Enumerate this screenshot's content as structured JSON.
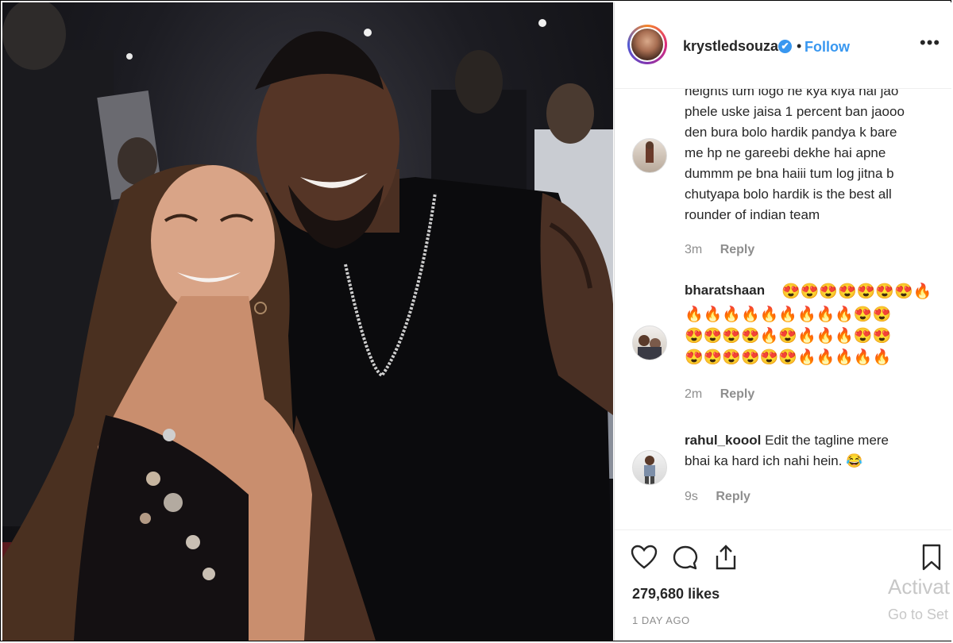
{
  "header": {
    "username": "krystledsouza",
    "verified_mark": "✔",
    "separator": "•",
    "follow_label": "Follow",
    "more_label": "•••"
  },
  "comments": [
    {
      "text_lines": [
        "heights tum logo ne kya kiya hai jao",
        "phele uske jaisa 1 percent ban jaooo",
        "den bura bolo hardik pandya k bare",
        "me hp ne gareebi dekhe hai apne",
        "dummm pe bna haiii tum log jitna b",
        "chutyapa bolo hardik is the best all",
        "rounder of indian team"
      ],
      "time": "3m",
      "reply_label": "Reply"
    },
    {
      "username": "bharatshaan",
      "emoji_lines": [
        "😍😍😍😍😍😍😍🔥",
        "🔥🔥🔥🔥🔥🔥🔥🔥🔥😍😍",
        "😍😍😍😍🔥😍🔥🔥🔥😍😍",
        "😍😍😍😍😍😍🔥🔥🔥🔥🔥"
      ],
      "time": "2m",
      "reply_label": "Reply"
    },
    {
      "username": "rahul_koool",
      "text_line1": "Edit the tagline mere",
      "text_line2": "bhai ka hard ich nahi hein. 😂",
      "time": "9s",
      "reply_label": "Reply"
    }
  ],
  "actions": {
    "icons": [
      "heart-icon",
      "comment-icon",
      "share-icon",
      "bookmark-icon"
    ],
    "likes": "279,680 likes",
    "date": "1 DAY AGO"
  },
  "watermark": {
    "line1": "Activat",
    "line2": "Go to Set"
  },
  "colors": {
    "link_blue": "#3897f0",
    "text": "#262626",
    "muted": "#8e8e8e"
  }
}
